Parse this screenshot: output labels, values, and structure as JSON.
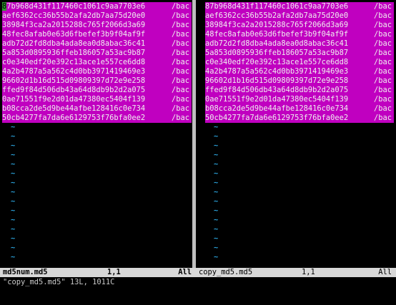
{
  "left_pane": {
    "lines": [
      {
        "hash": "87b968d431f117460c1061c9aa7703e6",
        "path": "/bac"
      },
      {
        "hash": "aef6362cc36b55b2afa2db7aa75d20e0",
        "path": "/bac"
      },
      {
        "hash": "38984f3ca2a2015288c765f2066d3a69",
        "path": "/bac"
      },
      {
        "hash": "48fec8afab0e63d6fbefef3b9f04af9f",
        "path": "/bac"
      },
      {
        "hash": "adb72d2fd8dba4ada8ea0d8abac36c41",
        "path": "/bac"
      },
      {
        "hash": "5a853d0895936ffeb186057a53ac9b87",
        "path": "/bac"
      },
      {
        "hash": "c0e340edf20e392c13ace1e557ce6dd8",
        "path": "/bac"
      },
      {
        "hash": "4a2b4787a5a562c4d0bb3971419469e3",
        "path": "/bac"
      },
      {
        "hash": "96602d1b16d515d09809397d72e9e258",
        "path": "/bac"
      },
      {
        "hash": "ffed9f84d506db43a64d8db9b2d2a075",
        "path": "/bac"
      },
      {
        "hash": "0ae71551f9e2d01da47380ec5404f139",
        "path": "/bac"
      },
      {
        "hash": "b08cca2de5d9be44afbe128416c0e734",
        "path": "/bac"
      },
      {
        "hash": "50cb4277fa7da6e6129753f76bfa0ee2",
        "path": "/bac"
      }
    ],
    "cursor_char": "8",
    "tilde": "~",
    "status": {
      "filename": "md5num.md5",
      "position": "1,1",
      "percent": "All"
    }
  },
  "right_pane": {
    "lines": [
      {
        "hash": "87b968d431f117460c1061c9aa7703e6",
        "path": "/bac"
      },
      {
        "hash": "aef6362cc36b55b2afa2db7aa75d20e0",
        "path": "/bac"
      },
      {
        "hash": "38984f3ca2a2015288c765f2066d3a69",
        "path": "/bac"
      },
      {
        "hash": "48fec8afab0e63d6fbefef3b9f04af9f",
        "path": "/bac"
      },
      {
        "hash": "adb72d2fd8dba4ada8ea0d8abac36c41",
        "path": "/bac"
      },
      {
        "hash": "5a853d0895936ffeb186057a53ac9b87",
        "path": "/bac"
      },
      {
        "hash": "c0e340edf20e392c13ace1e557ce6dd8",
        "path": "/bac"
      },
      {
        "hash": "4a2b4787a5a562c4d0bb3971419469e3",
        "path": "/bac"
      },
      {
        "hash": "96602d1b16d515d09809397d72e9e258",
        "path": "/bac"
      },
      {
        "hash": "ffed9f84d506db43a64d8db9b2d2a075",
        "path": "/bac"
      },
      {
        "hash": "0ae71551f9e2d01da47380ec5404f139",
        "path": "/bac"
      },
      {
        "hash": "b08cca2de5d9be44afbe128416c0e734",
        "path": "/bac"
      },
      {
        "hash": "50cb4277fa7da6e6129753f76bfa0ee2",
        "path": "/bac"
      }
    ],
    "tilde": "~",
    "status": {
      "filename": "copy_md5.md5",
      "position": "1,1",
      "percent": "All"
    }
  },
  "command_line": "\"copy_md5.md5\" 13L, 1011C",
  "colors": {
    "background": "#000000",
    "diff_highlight": "#c000c0",
    "cursor": "#2d9e2d",
    "tilde": "#2a9fd6",
    "status_bar": "#d8d8d8",
    "divider": "#bfbfbf"
  }
}
